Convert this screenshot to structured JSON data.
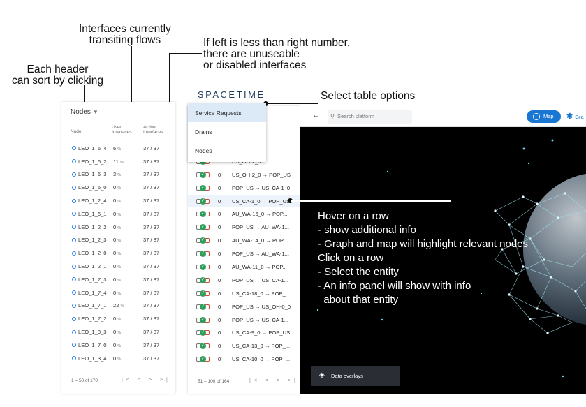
{
  "callouts": {
    "interfaces_flows": "Interfaces currently\ntransiting flows",
    "left_less_right": "If left is less than right number,\nthere are unuseable\nor disabled interfaces",
    "header_sort": "Each header\ncan sort by clicking",
    "select_options": "Select table options",
    "hover_info": "Hover on a row\n- show additional info\n- Graph and map will highlight relevant nodes\nClick on a row\n- Select the entity\n- An info panel will show with info\n  about that entity"
  },
  "brand": "SPACETIME",
  "left_table": {
    "title": "Nodes",
    "headers": {
      "node": "Node",
      "used": "Used\nInterfaces",
      "active": "Active\nInterfaces"
    },
    "rows": [
      {
        "node": "LEO_1_6_4",
        "used": "6",
        "pct": "%",
        "active": "37 / 37"
      },
      {
        "node": "LEO_1_6_2",
        "used": "11",
        "pct": "%",
        "active": "37 / 37"
      },
      {
        "node": "LEO_1_6_3",
        "used": "3",
        "pct": "%",
        "active": "37 / 37"
      },
      {
        "node": "LEO_1_6_0",
        "used": "0",
        "pct": "%",
        "active": "37 / 37"
      },
      {
        "node": "LEO_1_2_4",
        "used": "0",
        "pct": "%",
        "active": "37 / 37"
      },
      {
        "node": "LEO_1_6_1",
        "used": "0",
        "pct": "%",
        "active": "37 / 37"
      },
      {
        "node": "LEO_1_2_2",
        "used": "0",
        "pct": "%",
        "active": "37 / 37"
      },
      {
        "node": "LEO_1_2_3",
        "used": "0",
        "pct": "%",
        "active": "37 / 37"
      },
      {
        "node": "LEO_1_2_0",
        "used": "0",
        "pct": "%",
        "active": "37 / 37"
      },
      {
        "node": "LEO_1_2_1",
        "used": "0",
        "pct": "%",
        "active": "37 / 37"
      },
      {
        "node": "LEO_1_7_3",
        "used": "0",
        "pct": "%",
        "active": "37 / 37"
      },
      {
        "node": "LEO_1_7_4",
        "used": "0",
        "pct": "%",
        "active": "37 / 37"
      },
      {
        "node": "LEO_1_7_1",
        "used": "22",
        "pct": "%",
        "active": "37 / 37"
      },
      {
        "node": "LEO_1_7_2",
        "used": "0",
        "pct": "%",
        "active": "37 / 37"
      },
      {
        "node": "LEO_1_3_3",
        "used": "0",
        "pct": "%",
        "active": "37 / 37"
      },
      {
        "node": "LEO_1_7_0",
        "used": "0",
        "pct": "%",
        "active": "37 / 37"
      },
      {
        "node": "LEO_1_3_4",
        "used": "0",
        "pct": "%",
        "active": "37 / 37"
      }
    ],
    "footer": "1 – 50 of 170",
    "pager": "|< < > >|"
  },
  "menu": {
    "items": [
      {
        "label": "Service Requests",
        "selected": true
      },
      {
        "label": "Drains",
        "selected": false
      },
      {
        "label": "Nodes",
        "selected": false
      }
    ]
  },
  "mid_table": {
    "rows": [
      {
        "count": "",
        "flow": "→ POP..."
      },
      {
        "count": "",
        "flow": "US_OH-2_0"
      },
      {
        "count": "0",
        "flow": "US_OH-2_0 → POP_US"
      },
      {
        "count": "0",
        "flow": "POP_US → US_CA-1_0"
      },
      {
        "count": "0",
        "flow": "US_CA-1_0 → POP_US"
      },
      {
        "count": "0",
        "flow": "AU_WA-16_0 → POP..."
      },
      {
        "count": "0",
        "flow": "POP_US → AU_WA-1..."
      },
      {
        "count": "0",
        "flow": "AU_WA-14_0 → POP..."
      },
      {
        "count": "0",
        "flow": "POP_US → AU_WA-1..."
      },
      {
        "count": "0",
        "flow": "AU_WA-11_0 → POP..."
      },
      {
        "count": "0",
        "flow": "POP_US → US_CA-1..."
      },
      {
        "count": "0",
        "flow": "US_CA-18_0 → POP_..."
      },
      {
        "count": "0",
        "flow": "POP_US → US_OH-0_0"
      },
      {
        "count": "0",
        "flow": "POP_US → US_CA-1..."
      },
      {
        "count": "0",
        "flow": "US_CA-9_0 → POP_US"
      },
      {
        "count": "0",
        "flow": "US_CA-13_0 → POP_..."
      },
      {
        "count": "0",
        "flow": "US_CA-10_0 → POP_..."
      }
    ],
    "footer": "51 – 100 of 164",
    "pager": "|< < > >|"
  },
  "toolbar": {
    "back": "←",
    "search_placeholder": "Search platform",
    "map_label": "Map",
    "graph_label": "Gra"
  },
  "map": {
    "overlay_label": "Data overlays"
  }
}
